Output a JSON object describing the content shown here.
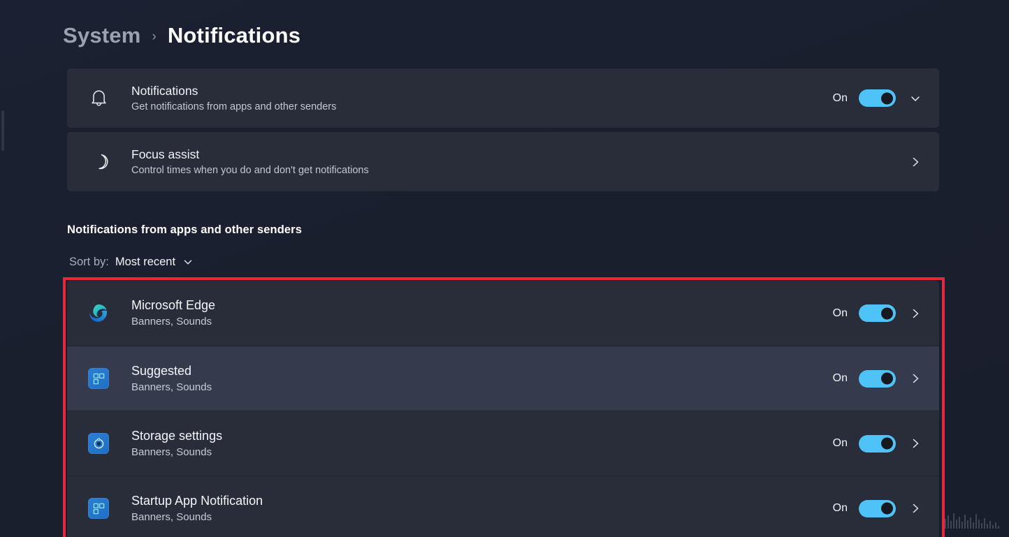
{
  "breadcrumb": {
    "parent": "System",
    "separator": "›",
    "current": "Notifications"
  },
  "cards": [
    {
      "icon": "bell-icon",
      "title": "Notifications",
      "subtitle": "Get notifications from apps and other senders",
      "state_label": "On",
      "toggle": true,
      "chevron": "chevron-down-icon"
    },
    {
      "icon": "moon-icon",
      "title": "Focus assist",
      "subtitle": "Control times when you do and don't get notifications",
      "state_label": "",
      "toggle": false,
      "chevron": "chevron-right-icon"
    }
  ],
  "section": {
    "heading": "Notifications from apps and other senders",
    "sort_label": "Sort by:",
    "sort_value": "Most recent",
    "sort_chevron": "chevron-down-icon"
  },
  "apps": [
    {
      "icon": "microsoft-edge-icon",
      "name": "Microsoft Edge",
      "detail": "Banners, Sounds",
      "state_label": "On",
      "toggle": true,
      "chevron": "chevron-right-icon",
      "highlighted": false
    },
    {
      "icon": "window-tile-icon",
      "name": "Suggested",
      "detail": "Banners, Sounds",
      "state_label": "On",
      "toggle": true,
      "chevron": "chevron-right-icon",
      "highlighted": true
    },
    {
      "icon": "storage-settings-icon",
      "name": "Storage settings",
      "detail": "Banners, Sounds",
      "state_label": "On",
      "toggle": true,
      "chevron": "chevron-right-icon",
      "highlighted": false
    },
    {
      "icon": "window-tile-icon",
      "name": "Startup App Notification",
      "detail": "Banners, Sounds",
      "state_label": "On",
      "toggle": true,
      "chevron": "chevron-right-icon",
      "highlighted": false
    }
  ],
  "annotation": {
    "name": "red-highlight-box",
    "color": "#e8273c"
  },
  "colors": {
    "page_background": "#1b2132",
    "card_background": "#282d39",
    "row_highlight": "#353b4d",
    "toggle_on": "#4fc3f7",
    "accent_text": "#ffffff"
  }
}
